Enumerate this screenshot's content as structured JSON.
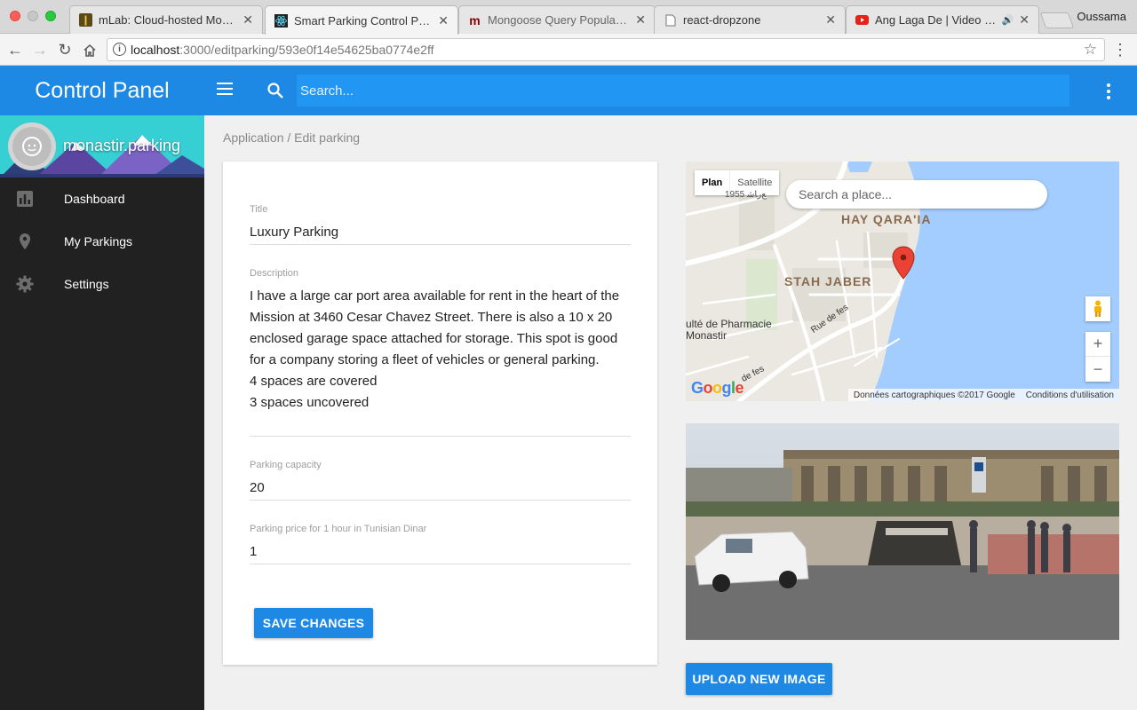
{
  "browser": {
    "tabs": [
      {
        "label": "mLab: Cloud-hosted MongoD",
        "favicon": "mlab-leaf-icon"
      },
      {
        "label": "Smart Parking Control Panel",
        "favicon": "react-icon"
      },
      {
        "label": "Mongoose Query Population",
        "favicon": "mongoose-m-icon"
      },
      {
        "label": "react-dropzone",
        "favicon": "page-icon"
      },
      {
        "label": "Ang Laga De | Video Song",
        "favicon": "youtube-icon"
      }
    ],
    "user": "Oussama",
    "url_host": "localhost",
    "url_path": ":3000/editparking/593e0f14e54625ba0774e2ff"
  },
  "sidebar": {
    "title": "Control Panel",
    "profile_name": "monastir.parking",
    "items": [
      {
        "label": "Dashboard",
        "icon": "bar-chart-icon"
      },
      {
        "label": "My Parkings",
        "icon": "location-pin-icon"
      },
      {
        "label": "Settings",
        "icon": "gear-icon"
      }
    ]
  },
  "appbar": {
    "search_placeholder": "Search..."
  },
  "breadcrumb": "Application / Edit parking",
  "form": {
    "title_label": "Title",
    "title_value": "Luxury Parking",
    "description_label": "Description",
    "description_value": "I have a large car port area available for rent in the heart of the Mission at 3460 Cesar Chavez Street. There is also a 10 x 20 enclosed garage space attached for storage. This spot is good for a company storing a fleet of vehicles or general parking.\n4 spaces are covered\n3 spaces uncovered",
    "capacity_label": "Parking capacity",
    "capacity_value": "20",
    "price_label": "Parking price for 1 hour in Tunisian Dinar",
    "price_value": "1",
    "save_label": "SAVE CHANGES"
  },
  "map": {
    "type_plan": "Plan",
    "type_satellite": "Satellite",
    "place_placeholder": "Search a place...",
    "label_hay": "HAY QARA'IA",
    "label_stah": "STAH JABER",
    "label_pharmacie": "ulté de Pharmacie\nMonastir",
    "label_rue1": "Rue de fes",
    "label_rue2": "de fes",
    "label_topleft": "ﻊﺭﺎﺷ 1955",
    "zoom_in": "+",
    "zoom_out": "−",
    "attribution": "Données cartographiques ©2017 Google",
    "terms": "Conditions d'utilisation",
    "logo": "Google"
  },
  "upload_label": "UPLOAD NEW IMAGE",
  "colors": {
    "primary": "#1e88e5",
    "sidebar_bg": "#212121",
    "water": "#a3ccff"
  }
}
